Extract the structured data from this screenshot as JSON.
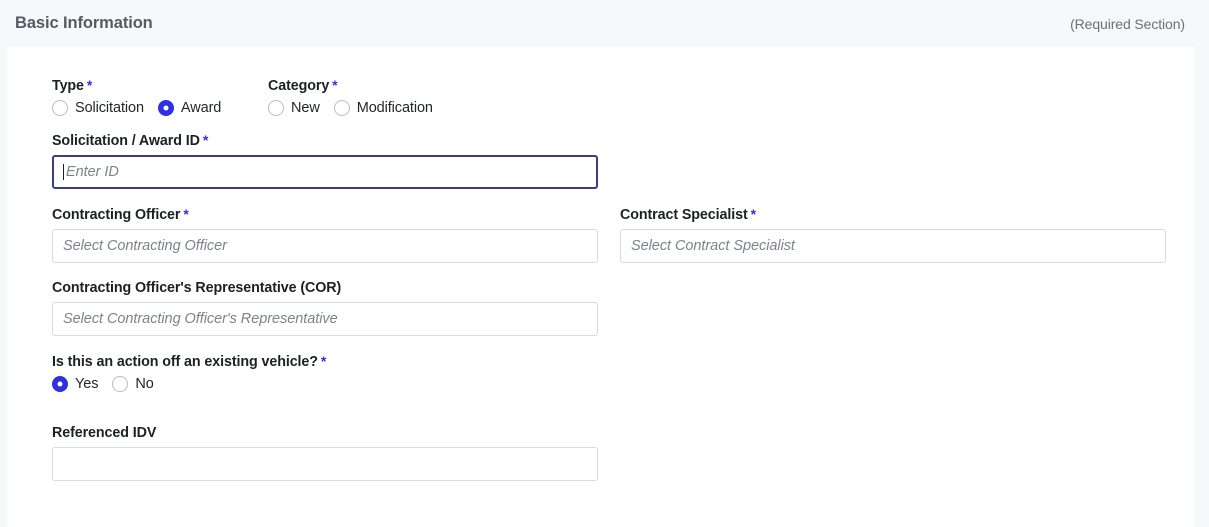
{
  "section": {
    "title": "Basic Information",
    "required_note": "(Required Section)"
  },
  "fields": {
    "type": {
      "label": "Type",
      "required": "*",
      "options": [
        {
          "label": "Solicitation",
          "selected": false
        },
        {
          "label": "Award",
          "selected": true
        }
      ]
    },
    "category": {
      "label": "Category",
      "required": "*",
      "options": [
        {
          "label": "New",
          "selected": false
        },
        {
          "label": "Modification",
          "selected": false
        }
      ]
    },
    "solicitation_award_id": {
      "label": "Solicitation / Award ID",
      "required": "*",
      "value": "",
      "placeholder": "Enter ID",
      "focused": true
    },
    "contracting_officer": {
      "label": "Contracting Officer",
      "required": "*",
      "value": "",
      "placeholder": "Select Contracting Officer"
    },
    "contract_specialist": {
      "label": "Contract Specialist",
      "required": "*",
      "value": "",
      "placeholder": "Select Contract Specialist"
    },
    "cor": {
      "label": "Contracting Officer's Representative (COR)",
      "value": "",
      "placeholder": "Select Contracting Officer's Representative"
    },
    "existing_vehicle": {
      "label": "Is this an action off an existing vehicle?",
      "required": "*",
      "options": [
        {
          "label": "Yes",
          "selected": true
        },
        {
          "label": "No",
          "selected": false
        }
      ]
    },
    "referenced_idv": {
      "label": "Referenced IDV",
      "value": "",
      "placeholder": ""
    }
  },
  "colors": {
    "accent": "#2f2fe3",
    "focus_border": "#3b3b8c",
    "header_bg": "#f7f8fa",
    "page_bg": "#f7f8fa",
    "border": "#d8dade"
  }
}
